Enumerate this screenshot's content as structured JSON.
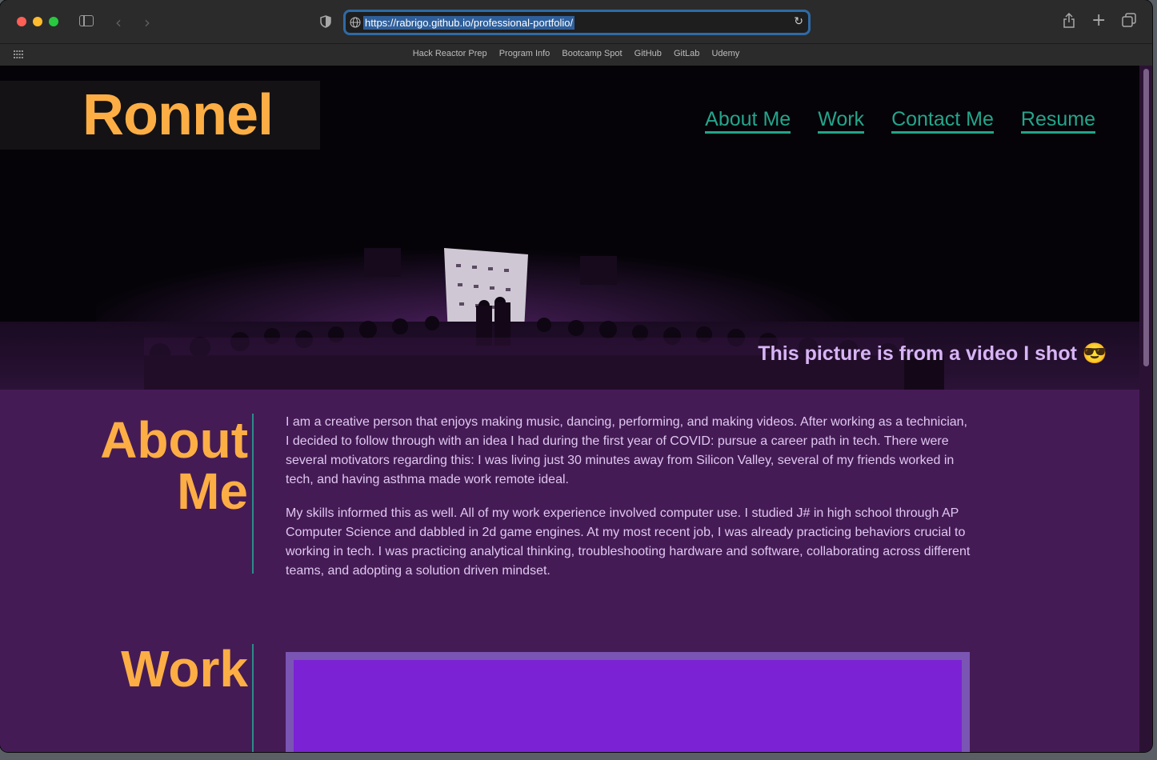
{
  "browser": {
    "url": "https://rabrigo.github.io/professional-portfolio/",
    "bookmarks": [
      "Hack Reactor Prep",
      "Program Info",
      "Bootcamp Spot",
      "GitHub",
      "GitLab",
      "Udemy"
    ]
  },
  "site": {
    "brand": "Ronnel",
    "nav": [
      {
        "label": "About Me"
      },
      {
        "label": "Work"
      },
      {
        "label": "Contact Me"
      },
      {
        "label": "Resume"
      }
    ],
    "hero_caption": "This picture is from a video I shot 😎",
    "about": {
      "title_line1": "About",
      "title_line2": "Me",
      "paragraph1": "I am a creative person that enjoys making music, dancing, performing, and making videos. After working as a technician, I decided to follow through with an idea I had during the first year of COVID: pursue a career path in tech. There were several motivators regarding this: I was living just 30 minutes away from Silicon Valley, several of my friends worked in tech, and having asthma made work remote ideal.",
      "paragraph2": "My skills informed this as well. All of my work experience involved computer use. I studied J# in high school through AP Computer Science and dabbled in 2d game engines. At my most recent job, I was already practicing behaviors crucial to working in tech. I was practicing analytical thinking, troubleshooting hardware and software, collaborating across different teams, and adopting a solution driven mindset."
    },
    "work": {
      "title": "Work"
    }
  },
  "colors": {
    "accent_orange": "#fcae45",
    "nav_teal": "#24a58b",
    "section_bg": "#451b56",
    "caption_lavender": "#d7b4f5"
  }
}
